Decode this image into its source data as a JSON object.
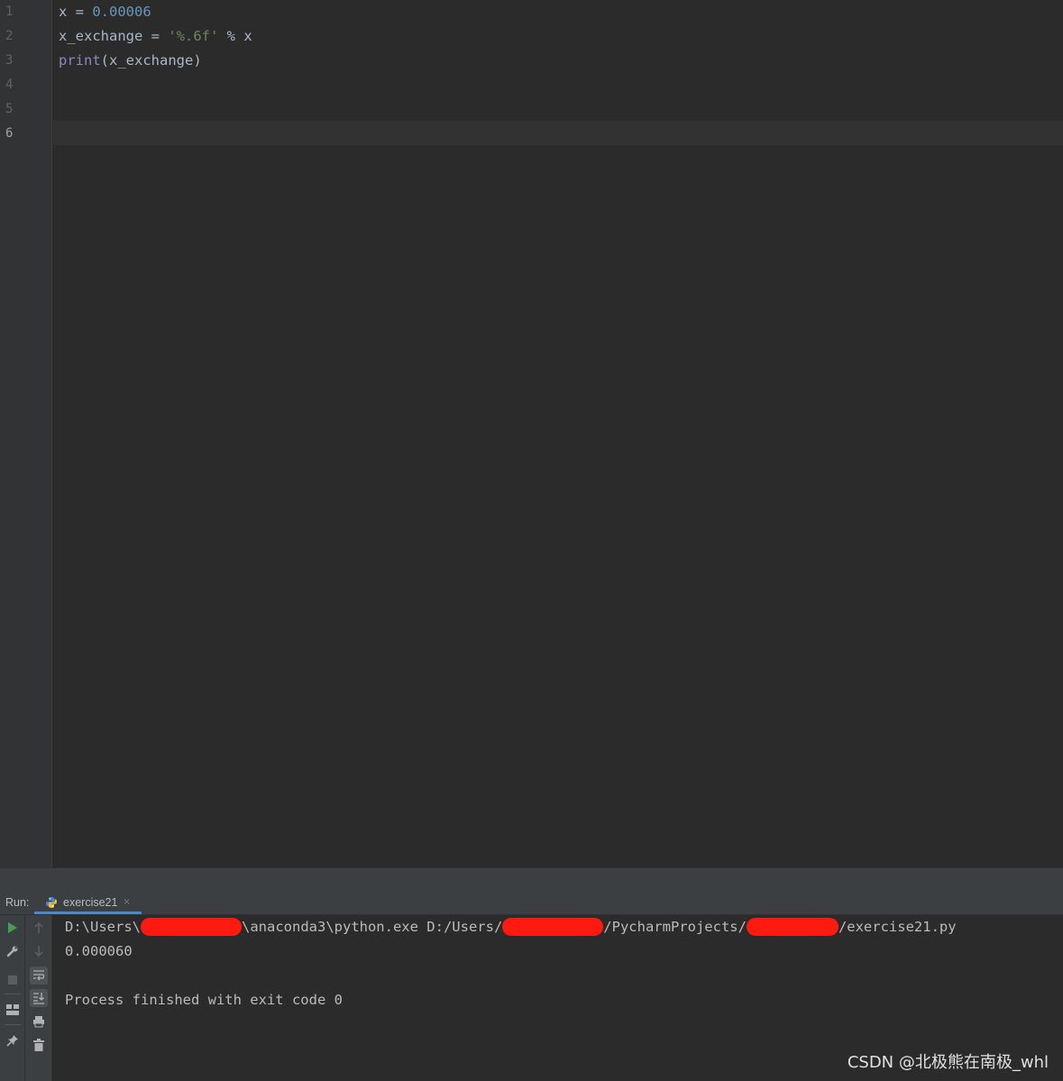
{
  "editor": {
    "line_numbers": [
      "1",
      "2",
      "3",
      "4",
      "5",
      "6"
    ],
    "current_line": "6",
    "code": [
      [
        {
          "t": "x = ",
          "c": "plain"
        },
        {
          "t": "0.00006",
          "c": "num"
        }
      ],
      [
        {
          "t": "x_exchange = ",
          "c": "plain"
        },
        {
          "t": "'%.6f'",
          "c": "str"
        },
        {
          "t": " % x",
          "c": "plain"
        }
      ],
      [
        {
          "t": "print",
          "c": "builtin"
        },
        {
          "t": "(x_exchange)",
          "c": "plain"
        }
      ]
    ]
  },
  "run_panel": {
    "label": "Run:",
    "tab_title": "exercise21",
    "tab_close": "×",
    "console": {
      "cmd_part1": "D:\\Users\\",
      "cmd_part2": "\\anaconda3\\python.exe D:/Users/",
      "cmd_part3": "/PycharmProjects/",
      "cmd_part4": "/exercise21.py",
      "output": "0.000060",
      "finished": "Process finished with exit code 0"
    }
  },
  "watermark": "CSDN @北极熊在南极_whl",
  "colors": {
    "redaction": "#ff1a0f",
    "number": "#6897bb",
    "string": "#6a8759",
    "builtin": "#8888c6",
    "run_icon": "#499c54"
  }
}
